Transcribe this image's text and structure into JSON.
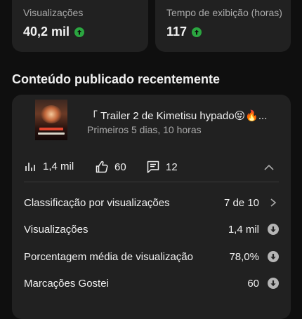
{
  "stats": [
    {
      "label": "Visualizações",
      "value": "40,2 mil",
      "trend": "up"
    },
    {
      "label": "Tempo de exibição (horas)",
      "value": "117",
      "trend": "up"
    }
  ],
  "colors": {
    "trend_up": "#2ba640",
    "card_bg": "#212121",
    "page_bg": "#0f0f0f"
  },
  "section": {
    "title": "Conteúdo publicado recentemente"
  },
  "video": {
    "title": "「 Trailer 2 de Kimetisu hypado😝🔥...",
    "subtitle": "Primeiros 5 dias, 10 horas",
    "views": "1,4 mil",
    "likes": "60",
    "comments": "12"
  },
  "rows": [
    {
      "label": "Classificação por visualizações",
      "value": "7 de 10",
      "icon": "chevron-right-icon"
    },
    {
      "label": "Visualizações",
      "value": "1,4 mil",
      "icon": "down-circle-icon"
    },
    {
      "label": "Porcentagem média de visualização",
      "value": "78,0%",
      "icon": "down-circle-icon"
    },
    {
      "label": "Marcações Gostei",
      "value": "60",
      "icon": "down-circle-icon"
    }
  ]
}
